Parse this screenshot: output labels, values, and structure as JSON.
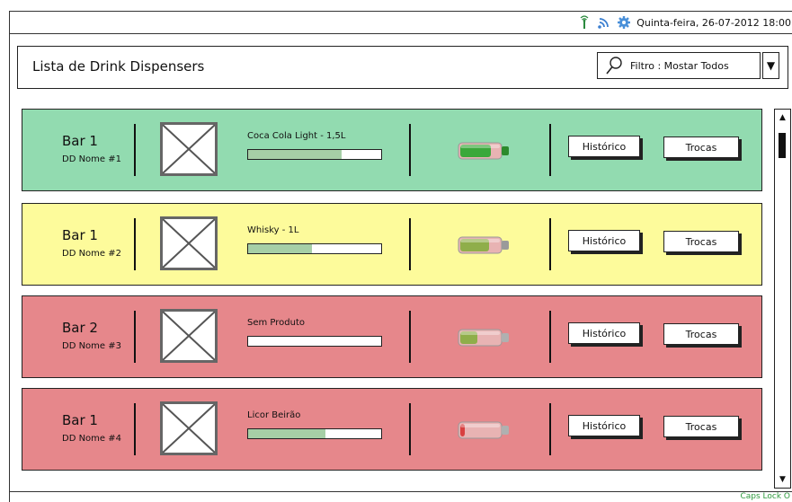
{
  "status_bar": {
    "datetime": "Quinta-feira, 26-07-2012 18:00",
    "icons": [
      "antenna-icon",
      "wifi-icon",
      "gear-icon"
    ]
  },
  "header": {
    "title": "Lista de Drink Dispensers",
    "filter_label": "Filtro : Mostar Todos",
    "dropdown_glyph": "▼"
  },
  "colors": {
    "ok": "#92dbb0",
    "warning": "#fdfb9b",
    "alert": "#e6878b",
    "level_fill": "#a6cfa6",
    "caps_lock": "#2e9a3e"
  },
  "buttons": {
    "history": "Histórico",
    "swap": "Trocas"
  },
  "dispensers": [
    {
      "bar": "Bar 1",
      "dd_name": "DD Nome #1",
      "product": "Coca Cola Light - 1,5L",
      "level": 0.7,
      "battery": "full",
      "status": "ok"
    },
    {
      "bar": "Bar 1",
      "dd_name": "DD Nome #2",
      "product": "Whisky - 1L",
      "level": 0.48,
      "battery": "medium",
      "status": "warning"
    },
    {
      "bar": "Bar 2",
      "dd_name": "DD Nome #3",
      "product": "Sem Produto",
      "level": 0,
      "battery": "half",
      "status": "alert"
    },
    {
      "bar": "Bar 1",
      "dd_name": "DD Nome #4",
      "product": "Licor Beirão",
      "level": 0.58,
      "battery": "low",
      "status": "alert"
    }
  ],
  "scrollbar": {
    "up": "▲",
    "down": "▼"
  },
  "footer": {
    "caps_lock": "Caps Lock O"
  }
}
